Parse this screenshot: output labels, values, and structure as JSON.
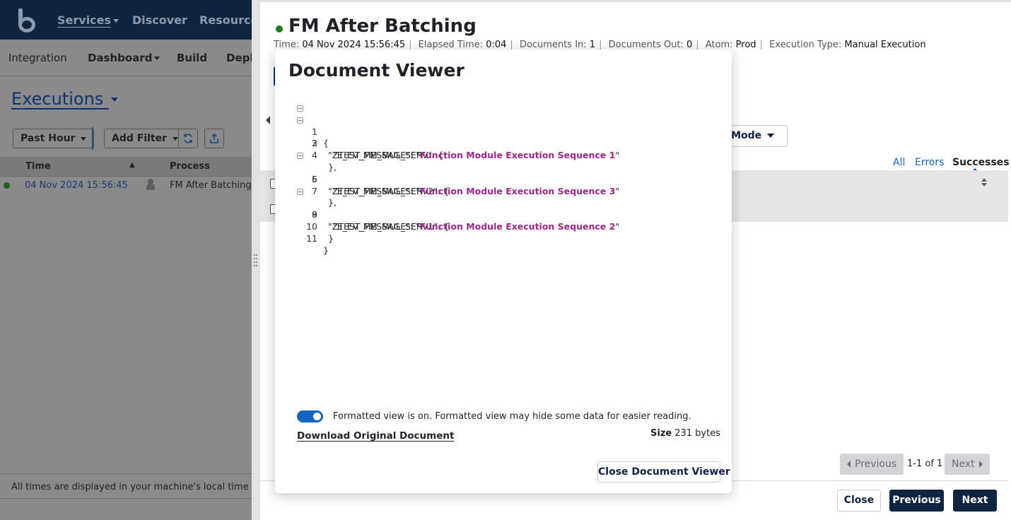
{
  "background": {
    "nav": {
      "services": "Services",
      "discover": "Discover",
      "resources": "Resources"
    },
    "subnav": {
      "integration": "Integration",
      "dashboard": "Dashboard",
      "build": "Build",
      "deploy": "Deploy"
    },
    "executions_title": "Executions",
    "toolbar": {
      "past_hour": "Past Hour",
      "add_filter": "Add Filter"
    },
    "table": {
      "columns": [
        "Time",
        "Process"
      ],
      "rows": [
        {
          "time": "04 Nov 2024 15:56:45",
          "process": "FM After Batching"
        }
      ]
    },
    "footer_note": "All times are displayed in your machine's local time zone, U"
  },
  "panel": {
    "title": "FM After Batching",
    "meta": [
      {
        "label": "Time:",
        "value": "04 Nov 2024 15:56:45"
      },
      {
        "label": "Elapsed Time:",
        "value": "0:04"
      },
      {
        "label": "Documents In:",
        "value": "1"
      },
      {
        "label": "Documents Out:",
        "value": "0"
      },
      {
        "label": "Atom:",
        "value": "Prod"
      },
      {
        "label": "Execution Type:",
        "value": "Manual Execution"
      }
    ],
    "test_mode_label": "Test Mode",
    "filter_tabs": {
      "all": "All",
      "errors": "Errors",
      "successes": "Successes"
    },
    "pager": {
      "previous": "Previous",
      "next": "Next",
      "count": "1-1 of 1"
    },
    "footer": {
      "close": "Close",
      "previous": "Previous",
      "next": "Next"
    }
  },
  "viewer": {
    "title": "Document Viewer",
    "lines": [
      {
        "n": "1",
        "key": "",
        "text": "{"
      },
      {
        "n": "2",
        "key": "\"ZTEST_FM_MUL_SERV\": {"
      },
      {
        "n": "3",
        "key": "\"E_EV_MESSAGE\": \"",
        "str": "Function Module Execution Sequence 1",
        "tail": "\""
      },
      {
        "n": "4",
        "text": "},"
      },
      {
        "n": "5",
        "key": "\"ZTEST_FM_MUL_SERV2\": {"
      },
      {
        "n": "6",
        "key": "\"E_EV_MESSAGE\": \"",
        "str": "Function Module Execution Sequence 3",
        "tail": "\""
      },
      {
        "n": "7",
        "text": "},"
      },
      {
        "n": "8",
        "key": "\"ZTEST_FM_MUL_SERV1\": {"
      },
      {
        "n": "9",
        "key": "\"E_EV_MESSAGE\": \"",
        "str": "Function Module Execution Sequence 2",
        "tail": "\""
      },
      {
        "n": "10",
        "text": "}"
      },
      {
        "n": "11",
        "text": "}"
      }
    ],
    "formatted_toggle_text": "Formatted view is on. Formatted view may hide some data for easier reading.",
    "formatted_on": true,
    "download_label": "Download Original Document",
    "size_label": "Size",
    "size_value": "231 bytes",
    "close_label": "Close Document Viewer"
  },
  "colors": {
    "navy": "#0e2440",
    "link": "#1565c0",
    "string": "#9c278a",
    "success": "#1e7a1e"
  }
}
